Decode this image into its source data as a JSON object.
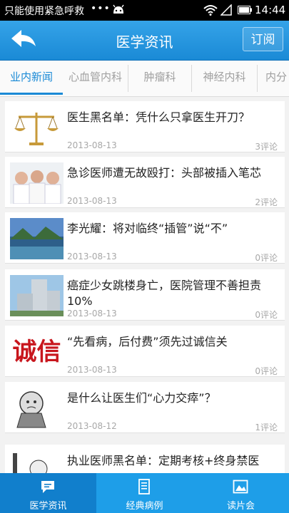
{
  "status_bar": {
    "carrier": "只能使用紧急呼救",
    "dots": "•••",
    "time": "14:44"
  },
  "header": {
    "title": "医学资讯",
    "subscribe_label": "订阅",
    "accent": "#1a8ad6"
  },
  "tabs": [
    "业内新闻",
    "心血管内科",
    "肿瘤科",
    "神经内科",
    "内分"
  ],
  "articles": [
    {
      "title": "医生黑名单：凭什么只拿医生开刀？",
      "date": "2013-08-13",
      "comments": "3评论",
      "image": "scales-image"
    },
    {
      "title": "急诊医师遭无故殴打：头部被插入笔芯",
      "date": "2013-08-13",
      "comments": "2评论",
      "image": "doctors-photo"
    },
    {
      "title": "李光耀：将对临终“插管”说“不”",
      "date": "2013-08-13",
      "comments": "0评论",
      "image": "landscape-photo"
    },
    {
      "title": "癌症少女跳楼身亡，医院管理不善担责10%",
      "date": "2013-08-13",
      "comments": "0评论",
      "image": "hospital-building-photo"
    },
    {
      "title": "“先看病，后付费”须先过诚信关",
      "date": "2013-08-13",
      "comments": "0评论",
      "image": "calligraphy-image",
      "image_text": "诚信"
    },
    {
      "title": "是什么让医生们“心力交瘁”？",
      "date": "2013-08-12",
      "comments": "1评论",
      "image": "cartoon-image"
    },
    {
      "title": "执业医师黑名单：定期考核+终身禁医",
      "date": "",
      "comments": "",
      "image": "cartoon-image-2"
    }
  ],
  "bottom_nav": [
    {
      "label": "医学资讯",
      "icon": "chat-icon"
    },
    {
      "label": "经典病例",
      "icon": "document-icon"
    },
    {
      "label": "读片会",
      "icon": "image-icon"
    }
  ]
}
